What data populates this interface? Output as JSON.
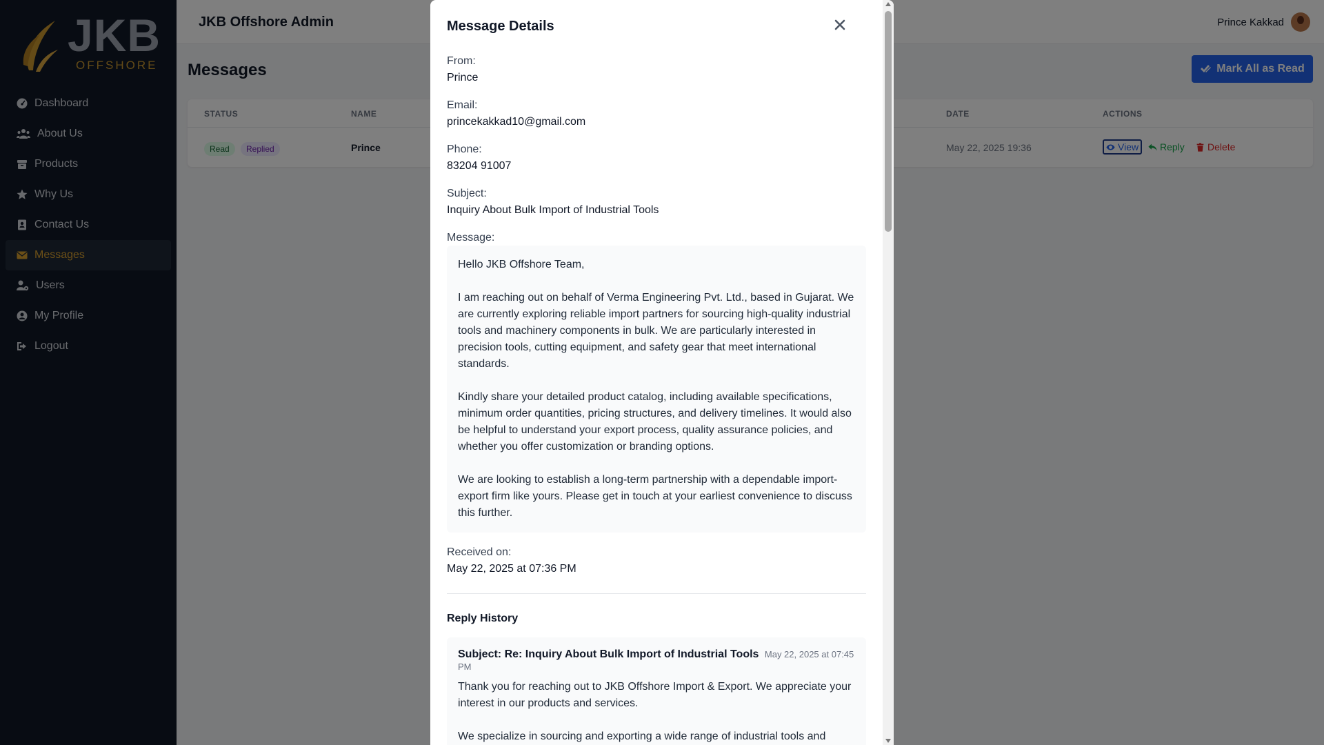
{
  "sidebar": {
    "logo_text": "JKB",
    "logo_sub": "OFFSHORE",
    "items": [
      {
        "label": "Dashboard",
        "icon": "dashboard-icon"
      },
      {
        "label": "About Us",
        "icon": "users-icon"
      },
      {
        "label": "Products",
        "icon": "box-icon"
      },
      {
        "label": "Why Us",
        "icon": "star-icon"
      },
      {
        "label": "Contact Us",
        "icon": "contact-card-icon"
      },
      {
        "label": "Messages",
        "icon": "envelope-icon",
        "active": true
      },
      {
        "label": "Users",
        "icon": "user-cog-icon"
      },
      {
        "label": "My Profile",
        "icon": "user-circle-icon"
      },
      {
        "label": "Logout",
        "icon": "logout-icon"
      }
    ]
  },
  "header": {
    "title": "JKB Offshore Admin",
    "user_name": "Prince Kakkad"
  },
  "main": {
    "page_title": "Messages",
    "mark_all_label": "Mark All as Read",
    "table": {
      "columns": [
        "STATUS",
        "NAME",
        "DATE",
        "ACTIONS"
      ],
      "rows": [
        {
          "status": [
            "Read",
            "Replied"
          ],
          "name": "Prince",
          "date": "May 22, 2025 19:36",
          "actions": [
            "View",
            "Reply",
            "Delete"
          ]
        }
      ]
    }
  },
  "modal": {
    "title": "Message Details",
    "from_label": "From:",
    "from_value": "Prince",
    "email_label": "Email:",
    "email_value": "princekakkad10@gmail.com",
    "phone_label": "Phone:",
    "phone_value": "83204 91007",
    "subject_label": "Subject:",
    "subject_value": "Inquiry About Bulk Import of Industrial Tools",
    "message_label": "Message:",
    "message_paragraphs": [
      "Hello JKB Offshore Team,",
      "I am reaching out on behalf of Verma Engineering Pvt. Ltd., based in Gujarat. We are currently exploring reliable import partners for sourcing high-quality industrial tools and machinery components in bulk. We are particularly interested in precision tools, cutting equipment, and safety gear that meet international standards.",
      "Kindly share your detailed product catalog, including available specifications, minimum order quantities, pricing structures, and delivery timelines. It would also be helpful to understand your export process, quality assurance policies, and whether you offer customization or branding options.",
      "We are looking to establish a long-term partnership with a dependable import-export firm like yours. Please get in touch at your earliest convenience to discuss this further."
    ],
    "received_label": "Received on:",
    "received_value": "May 22, 2025 at 07:36 PM",
    "reply_history_label": "Reply History",
    "reply": {
      "subject": "Subject: Re: Inquiry About Bulk Import of Industrial Tools",
      "date": "May 22, 2025 at 07:45 PM",
      "paragraphs": [
        "Thank you for reaching out to JKB Offshore Import & Export. We appreciate your interest in our products and services.",
        "We specialize in sourcing and exporting a wide range of industrial tools and machinery components that adhere to international quality standards. Based on"
      ]
    }
  },
  "colors": {
    "sidebar_bg": "#111827",
    "accent_gold": "#d69e2e",
    "primary_blue": "#2563eb"
  }
}
